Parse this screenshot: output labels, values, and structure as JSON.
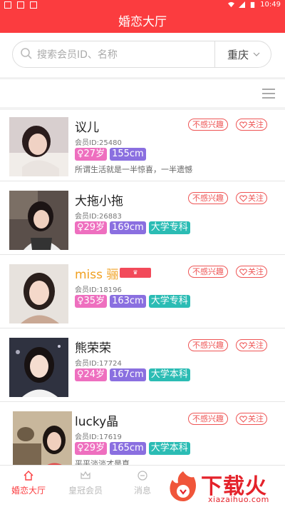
{
  "status_bar": {
    "time": "10:49"
  },
  "header": {
    "title": "婚恋大厅"
  },
  "search": {
    "placeholder": "搜索会员ID、名称",
    "value": ""
  },
  "city": {
    "selected": "重庆"
  },
  "members": [
    {
      "name": "议儿",
      "member_id": "会员ID:25480",
      "age": "♀27岁",
      "height": "155cm",
      "education": "",
      "motto": "所谓生活就是一半惊喜，一半遗憾",
      "not_interested": "不感兴趣",
      "follow": "关注"
    },
    {
      "name": "大拖小拖",
      "member_id": "会员ID:26883",
      "age": "♀29岁",
      "height": "169cm",
      "education": "大学专科",
      "motto": "",
      "not_interested": "不感兴趣",
      "follow": "关注"
    },
    {
      "name": "miss 骊",
      "member_id": "会员ID:18196",
      "age": "♀35岁",
      "height": "163cm",
      "education": "大学专科",
      "motto": "",
      "vip": true,
      "not_interested": "不感兴趣",
      "follow": "关注"
    },
    {
      "name": "熊荣荣",
      "member_id": "会员ID:17724",
      "age": "♀24岁",
      "height": "167cm",
      "education": "大学本科",
      "motto": "",
      "not_interested": "不感兴趣",
      "follow": "关注"
    },
    {
      "name": "lucky晶",
      "member_id": "会员ID:17619",
      "age": "♀29岁",
      "height": "165cm",
      "education": "大学本科",
      "motto": "平平淡淡才是真",
      "not_interested": "不感兴趣",
      "follow": "关注"
    }
  ],
  "bottom_nav": [
    {
      "label": "婚恋大厅",
      "icon": "home-icon",
      "active": true
    },
    {
      "label": "皇冠会员",
      "icon": "crown-icon",
      "active": false
    },
    {
      "label": "消息",
      "icon": "message-icon",
      "active": false
    }
  ],
  "watermark": {
    "logo_text": "下载火",
    "sub_text": "xiazaihuo.com"
  },
  "colors": {
    "primary": "#fb3c3f",
    "age_tag": "#ee6fbf",
    "height_tag": "#8a6fe0",
    "edu_tag": "#2bbcb4",
    "vip_name": "#f0a020"
  }
}
